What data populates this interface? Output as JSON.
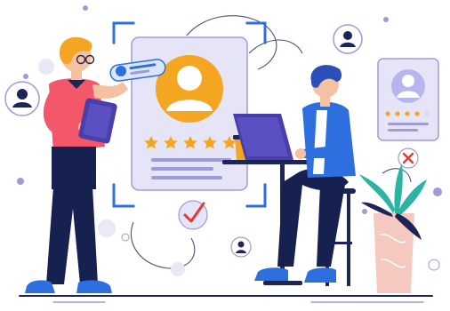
{
  "illustration": {
    "type": "flat vector illustration",
    "rating_stars_main": 5,
    "rating_stars_side": 4,
    "rating_stars_side_max": 5,
    "colors": {
      "background": "#ffffff",
      "card_fill": "#e6e5f7",
      "card_stroke": "#9d9bd8",
      "avatar_orange": "#f4a622",
      "star": "#f4a622",
      "accent_blue": "#2e6fe0",
      "navy": "#1d2556",
      "pants_navy": "#172150",
      "shirt_red": "#f2576a",
      "hair_orange": "#f4a622",
      "hair_blue": "#2b4fb8",
      "skin": "#f6c1a0",
      "plant_teal": "#2bb3a3",
      "pot_pink": "#f6c9c0",
      "reject_red": "#e53935",
      "check_red": "#e53935",
      "light_circle": "#e9e8f6"
    },
    "icons": [
      "user-profile-icon",
      "star-icon",
      "checkmark-icon",
      "close-icon",
      "laptop-icon",
      "tablet-icon",
      "coffee-cup-icon"
    ]
  }
}
